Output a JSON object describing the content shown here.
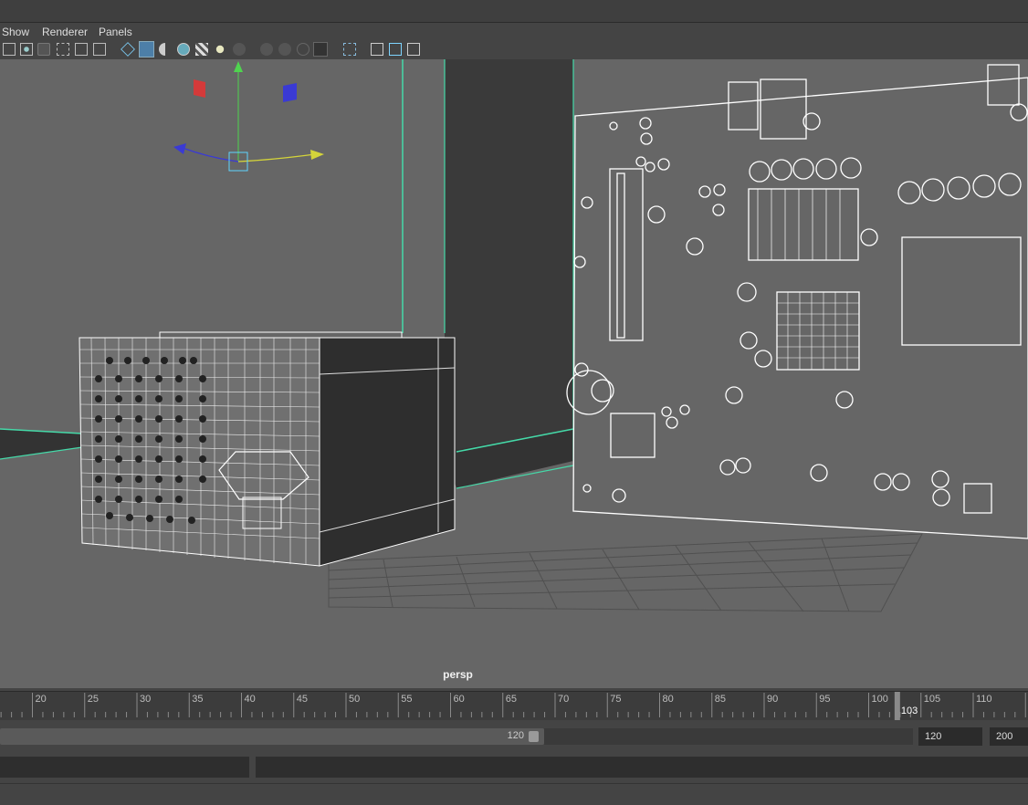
{
  "menu": {
    "show": "Show",
    "renderer": "Renderer",
    "panels": "Panels"
  },
  "toolbar_icons": [
    "select-camera-icon",
    "camera-attributes-icon",
    "bookmark-icon",
    "image-plane-icon",
    "2d-pan-zoom-icon",
    "grease-pencil-icon",
    "wireframe-icon",
    "smooth-shade-icon",
    "default-material-icon",
    "xray-icon",
    "shadows-icon",
    "lights-icon",
    "screen-space-ao-icon",
    "motion-blur-icon",
    "multisample-aa-icon",
    "depth-of-field-icon",
    "isolate-select-icon",
    "xray-joints-icon",
    "grid-icon",
    "resolution-gate-icon",
    "gate-mask-icon"
  ],
  "viewport": {
    "camera_label": "persp"
  },
  "timeline": {
    "ticks": [
      "20",
      "25",
      "30",
      "35",
      "40",
      "45",
      "50",
      "55",
      "60",
      "65",
      "70",
      "75",
      "80",
      "85",
      "90",
      "95",
      "100",
      "105",
      "110"
    ],
    "current_frame": "103"
  },
  "range": {
    "slider_end": "120",
    "anim_end": "120",
    "playback_end": "200"
  },
  "colors": {
    "viewport_bg": "#666666",
    "selection_green": "#45d9a8",
    "axis_x": "#d4d43a",
    "axis_y": "#4fd44f",
    "axis_z": "#3a3ad4",
    "current_frame_marker": "#8a8a8a"
  }
}
